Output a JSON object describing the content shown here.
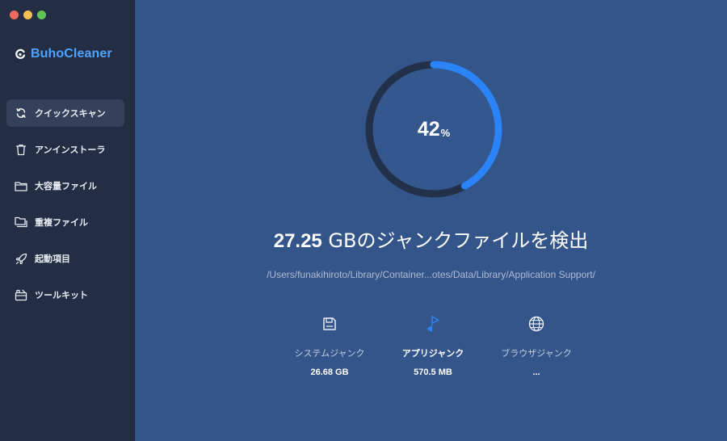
{
  "app": {
    "name": "BuhoCleaner"
  },
  "sidebar": {
    "items": [
      {
        "label": "クイックスキャン",
        "icon": "refresh-icon",
        "active": true
      },
      {
        "label": "アンインストーラ",
        "icon": "trash-icon"
      },
      {
        "label": "大容量ファイル",
        "icon": "folder-icon"
      },
      {
        "label": "重複ファイル",
        "icon": "duplicate-folder-icon"
      },
      {
        "label": "起動項目",
        "icon": "rocket-icon"
      },
      {
        "label": "ツールキット",
        "icon": "toolbox-icon"
      }
    ]
  },
  "scan": {
    "progress": {
      "value": 42,
      "unit": "%"
    },
    "headline": {
      "size": "27.25",
      "text": " GBのジャンクファイルを検出"
    },
    "current_path": "/Users/funakihiroto/Library/Container...otes/Data/Library/Application Support/",
    "categories": [
      {
        "label": "システムジャンク",
        "value": "26.68 GB",
        "icon": "disk-icon",
        "active": false
      },
      {
        "label": "アプリジャンク",
        "value": "570.5 MB",
        "icon": "app-flag-icon",
        "active": true
      },
      {
        "label": "ブラウザジャンク",
        "value": "...",
        "icon": "globe-icon",
        "active": false
      }
    ]
  },
  "colors": {
    "accent": "#2b84f7",
    "brand": "#4ea3ff",
    "sidebar_bg": "#232e44",
    "main_bg": "#34558a",
    "ring_track": "#223149"
  }
}
